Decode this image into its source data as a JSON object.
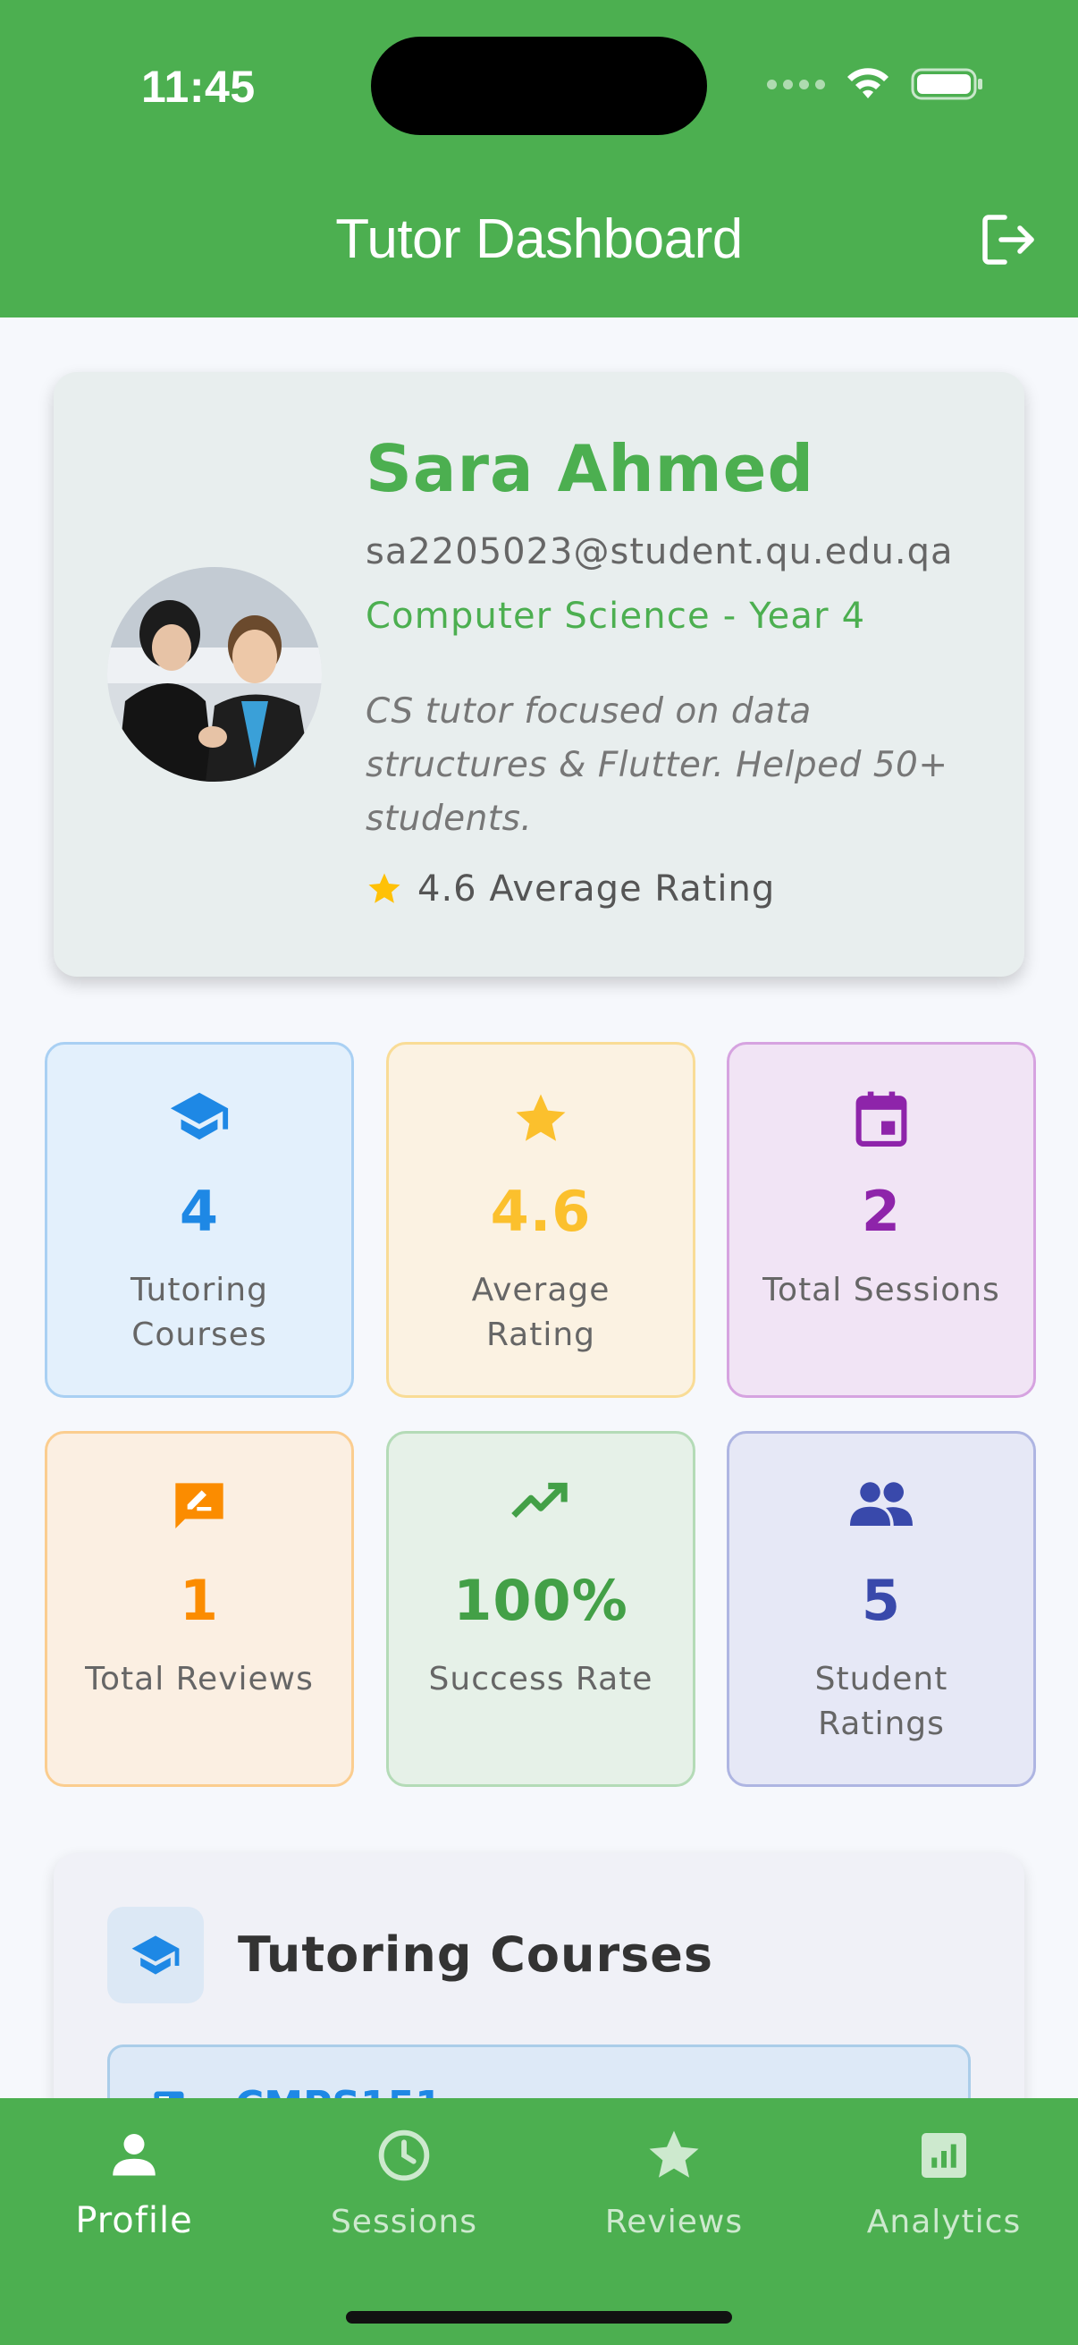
{
  "status_bar": {
    "time": "11:45"
  },
  "app_bar": {
    "title": "Tutor Dashboard",
    "logout_icon": "logout-icon"
  },
  "profile": {
    "name": "Sara Ahmed",
    "email": "sa2205023@student.qu.edu.qa",
    "department": "Computer Science - Year 4",
    "bio": "CS tutor focused on data structures & Flutter. Helped 50+ students.",
    "rating_text": "4.6 Average Rating",
    "accent_color": "#4caf50",
    "star_color": "#ffc107"
  },
  "stats": [
    {
      "icon": "school-icon",
      "value": "4",
      "label": "Tutoring Courses",
      "color": "#1e88e5",
      "bg": "#e3f0fc",
      "border": "#a9d0f3"
    },
    {
      "icon": "star-icon",
      "value": "4.6",
      "label": "Average Rating",
      "color": "#fbc02d",
      "bg": "#fbf2e2",
      "border": "#f9dc96"
    },
    {
      "icon": "calendar-icon",
      "value": "2",
      "label": "Total Sessions",
      "color": "#8e24aa",
      "bg": "#f1e4f5",
      "border": "#d6a3e0"
    },
    {
      "icon": "rate-review-icon",
      "value": "1",
      "label": "Total Reviews",
      "color": "#fb8c00",
      "bg": "#fbefe2",
      "border": "#fbcd8f"
    },
    {
      "icon": "trending-up-icon",
      "value": "100%",
      "label": "Success Rate",
      "color": "#43a047",
      "bg": "#e6f1e8",
      "border": "#b4dbb7"
    },
    {
      "icon": "people-icon",
      "value": "5",
      "label": "Student Ratings",
      "color": "#3949ab",
      "bg": "#e6e8f6",
      "border": "#aeb5e2"
    }
  ],
  "courses": {
    "title": "Tutoring Courses",
    "items": [
      {
        "code": "CMPS151"
      }
    ]
  },
  "bottom_nav": {
    "items": [
      {
        "label": "Profile",
        "icon": "person-icon",
        "active": true
      },
      {
        "label": "Sessions",
        "icon": "clock-icon",
        "active": false
      },
      {
        "label": "Reviews",
        "icon": "star-icon",
        "active": false
      },
      {
        "label": "Analytics",
        "icon": "analytics-icon",
        "active": false
      }
    ]
  }
}
